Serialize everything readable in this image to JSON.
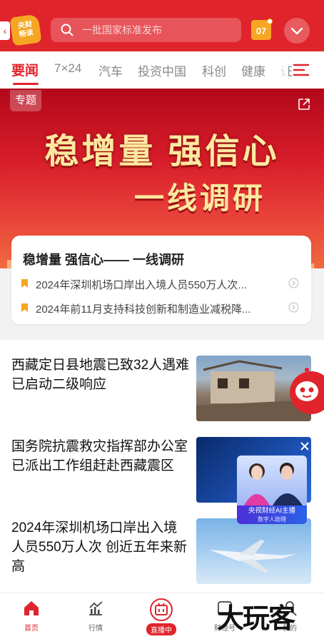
{
  "header": {
    "logo_text": "央财\n畅读",
    "search_placeholder": "一批国家标准发布",
    "calendar_day": "07"
  },
  "tabs": [
    {
      "label": "要闻"
    },
    {
      "label": "7×24"
    },
    {
      "label": "汽车"
    },
    {
      "label": "投资中国"
    },
    {
      "label": "科创"
    },
    {
      "label": "健康"
    },
    {
      "label": "证"
    }
  ],
  "banner": {
    "badge": "专题",
    "title_line1": "稳增量 强信心",
    "title_line2": "一线调研"
  },
  "topic": {
    "title": "稳增量 强信心—— 一线调研",
    "items": [
      {
        "text": "2024年深圳机场口岸出入境人员550万人次..."
      },
      {
        "text": "2024年前11月支持科技创新和制造业减税降..."
      }
    ]
  },
  "news": [
    {
      "title": "西藏定日县地震已致32人遇难 已启动二级响应"
    },
    {
      "title": "国务院抗震救灾指挥部办公室已派出工作组赶赴西藏震区"
    },
    {
      "title": "2024年深圳机场口岸出入境人员550万人次 创近五年来新高"
    }
  ],
  "anchor": {
    "label": "央视财经AI主播",
    "sublabel": "数字人助理"
  },
  "bottom_nav": [
    {
      "label": "首页"
    },
    {
      "label": "行情"
    },
    {
      "label": "直播中"
    },
    {
      "label": "财经号"
    },
    {
      "label": "我的"
    }
  ],
  "watermark": "大玩客",
  "colors": {
    "brand_red": "#e0242b",
    "gold": "#f5a623"
  }
}
